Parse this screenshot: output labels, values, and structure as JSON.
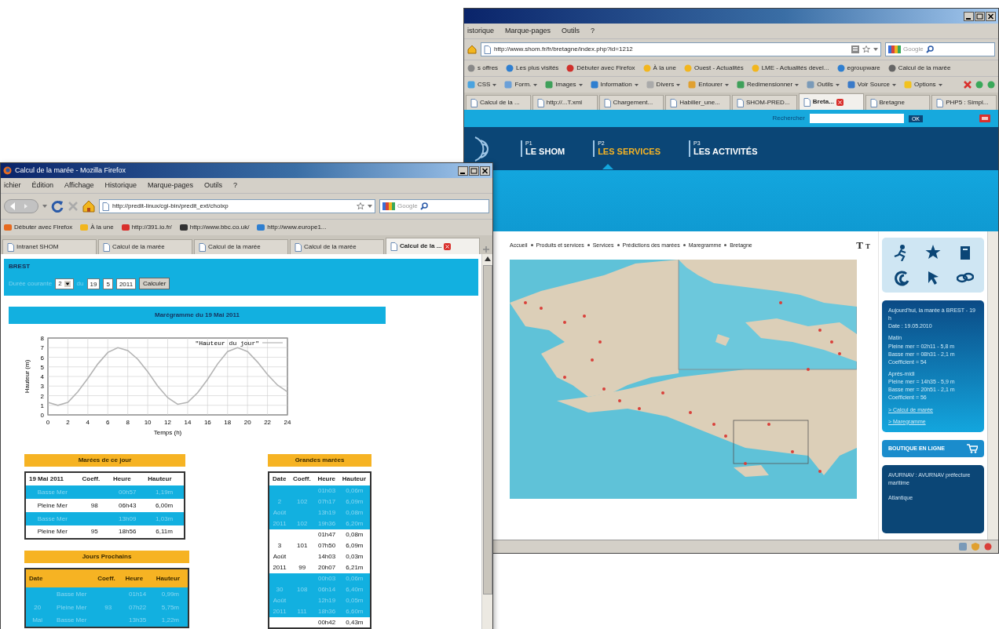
{
  "back_window": {
    "menu": [
      "istorique",
      "Marque-pages",
      "Outils",
      "?"
    ],
    "address": "http://www.shom.fr/fr/bretagne/index.php?id=1212",
    "search_placeholder": "Google",
    "bookmarks": [
      "s offres",
      "Les plus visités",
      "Débuter avec Firefox",
      "À la une",
      "Ouest - Actualités",
      "LME - Actualités devel...",
      "egroupware",
      "Calcul de la marée"
    ],
    "toolbar": [
      "CSS",
      "Form.",
      "Images",
      "Information",
      "Divers",
      "Entourer",
      "Redimensionner",
      "Outils",
      "Voir Source",
      "Options"
    ],
    "tabs": [
      {
        "label": "Calcul de la ...",
        "selected": false
      },
      {
        "label": "http://...T.xml",
        "selected": false
      },
      {
        "label": "Chargement...",
        "selected": false
      },
      {
        "label": "Habiller_une...",
        "selected": false
      },
      {
        "label": "SHOM-PRED...",
        "selected": false
      },
      {
        "label": "Breta...",
        "selected": true
      },
      {
        "label": "Bretagne",
        "selected": false
      },
      {
        "label": "PHP5 : Simpl...",
        "selected": false
      }
    ],
    "page": {
      "search_label": "Rechercher",
      "search_button": "OK",
      "nav": [
        {
          "number": "P1",
          "label": "LE SHOM",
          "selected": false
        },
        {
          "number": "P2",
          "label": "LES SERVICES",
          "selected": true
        },
        {
          "number": "P3",
          "label": "LES ACTIVITÉS",
          "selected": false
        }
      ],
      "breadcrumb": [
        "Accueil",
        "Produits et services",
        "Services",
        "Prédictions des marées",
        "Maregramme",
        "Bretagne"
      ],
      "text_size": [
        "T",
        "T"
      ],
      "tide_panel": [
        {
          "kind": "text",
          "text": "Aujourd'hui, la marée à BREST - 19 h"
        },
        {
          "kind": "text",
          "text": "Date : 19.05.2010"
        },
        {
          "kind": "heading",
          "text": "Matin"
        },
        {
          "kind": "text",
          "text": "Pleine mer = 02h11 - 5,8 m"
        },
        {
          "kind": "text",
          "text": "Basse mer = 08h31 - 2,1 m"
        },
        {
          "kind": "text",
          "text": "Coefficient = 54"
        },
        {
          "kind": "heading",
          "text": "Après-midi"
        },
        {
          "kind": "text",
          "text": "Pleine mer = 14h35 - 5,9 m"
        },
        {
          "kind": "text",
          "text": "Basse mer = 20h51 - 2,1 m"
        },
        {
          "kind": "text",
          "text": "Coefficient = 56"
        },
        {
          "kind": "link",
          "text": "> Calcul de marée"
        },
        {
          "kind": "link",
          "text": "> Maregramme"
        }
      ],
      "shop_button": "BOUTIQUE EN LIGNE",
      "notice_panel": [
        "AVURNAV : AVURNAV préfecture maritime",
        "Atlantique"
      ]
    }
  },
  "front_window": {
    "title": "Calcul de la marée - Mozilla Firefox",
    "menu": [
      "ichier",
      "Édition",
      "Affichage",
      "Historique",
      "Marque-pages",
      "Outils",
      "?"
    ],
    "address": "http://predit-linux/cgi-bin/predit_ext/choixp",
    "search_placeholder": "Google",
    "bookmarks": [
      "Débuter avec Firefox",
      "À la une",
      "http://391.io.fr/",
      "http://www.bbc.co.uk/",
      "http://www.europe1..."
    ],
    "tabs": [
      {
        "label": "Intranet SHOM",
        "selected": false
      },
      {
        "label": "Calcul de la marée",
        "selected": false
      },
      {
        "label": "Calcul de la marée",
        "selected": false
      },
      {
        "label": "Calcul de la marée",
        "selected": false
      },
      {
        "label": "Calcul de la ...",
        "selected": true
      }
    ],
    "page": {
      "port": "BREST",
      "form": {
        "label": "Durée courante",
        "select": "2",
        "date_label": "du",
        "day": "19",
        "month": "5",
        "year": "2011",
        "button": "Calculer"
      },
      "chart_title": "Marégramme du 19 Mai 2011",
      "chart_data": {
        "type": "line",
        "xlabel": "Temps (h)",
        "ylabel": "Hauteur (m)",
        "x": [
          0,
          1,
          2,
          3,
          4,
          5,
          6,
          7,
          8,
          9,
          10,
          11,
          12,
          13,
          14,
          15,
          16,
          17,
          18,
          19,
          20,
          21,
          22,
          23,
          24
        ],
        "series": [
          {
            "name": "\"Hauteur du jour\"",
            "color": "#b4b4b4",
            "values": [
              1.3,
              1.0,
              1.3,
              2.4,
              3.8,
              5.3,
              6.5,
              7.0,
              6.7,
              5.8,
              4.5,
              3.0,
              1.8,
              1.1,
              1.3,
              2.3,
              3.7,
              5.3,
              6.6,
              7.0,
              6.6,
              5.5,
              4.2,
              3.1,
              2.4
            ]
          }
        ],
        "xlim": [
          0,
          24
        ],
        "ylim": [
          0,
          8
        ],
        "grid": true,
        "xticks": [
          0,
          2,
          4,
          6,
          8,
          10,
          12,
          14,
          16,
          18,
          20,
          22,
          24
        ],
        "yticks": [
          0,
          1,
          2,
          3,
          4,
          5,
          6,
          7,
          8
        ]
      },
      "today": {
        "title": "Marées de ce jour",
        "columns": [
          "19 Mai 2011",
          "Coeff.",
          "Heure",
          "Hauteur"
        ],
        "rows": [
          {
            "highlighted": true,
            "cells": [
              "Basse Mer",
              null,
              "00h57",
              "1,19m"
            ]
          },
          {
            "highlighted": false,
            "cells": [
              "Pleine Mer",
              "98",
              "06h43",
              "6,00m"
            ]
          },
          {
            "highlighted": true,
            "cells": [
              "Basse Mer",
              null,
              "13h09",
              "1,03m"
            ]
          },
          {
            "highlighted": false,
            "cells": [
              "Pleine Mer",
              "95",
              "18h56",
              "6,11m"
            ]
          }
        ]
      },
      "next_days": {
        "title": "Jours Prochains",
        "columns": [
          "Date",
          null,
          "Coeff.",
          "Heure",
          "Hauteur"
        ],
        "rows": [
          {
            "highlighted": true,
            "cells": [
              null,
              "Basse Mer",
              null,
              "01h14",
              "0,99m"
            ]
          },
          {
            "highlighted": true,
            "cells": [
              "20",
              "Pleine Mer",
              "93",
              "07h22",
              "5,75m"
            ]
          },
          {
            "highlighted": true,
            "cells": [
              "Mai",
              "Basse Mer",
              null,
              "13h35",
              "1,22m"
            ]
          }
        ]
      },
      "spring_tides": {
        "title": "Grandes marées",
        "columns": [
          "Date",
          "Coeff.",
          "Heure",
          "Hauteur"
        ],
        "rows": [
          {
            "highlighted": true,
            "cells": [
              null,
              null,
              "01h03",
              "0,06m"
            ]
          },
          {
            "highlighted": true,
            "cells": [
              "2",
              "102",
              "07h17",
              "6,09m"
            ]
          },
          {
            "highlighted": true,
            "cells": [
              "Août",
              null,
              "13h19",
              "0,08m"
            ]
          },
          {
            "highlighted": true,
            "cells": [
              "2011",
              "102",
              "19h36",
              "6,20m"
            ]
          },
          {
            "highlighted": false,
            "cells": [
              null,
              null,
              "01h47",
              "0,08m"
            ]
          },
          {
            "highlighted": false,
            "cells": [
              "3",
              "101",
              "07h50",
              "6,09m"
            ]
          },
          {
            "highlighted": false,
            "cells": [
              "Août",
              null,
              "14h03",
              "0,03m"
            ]
          },
          {
            "highlighted": false,
            "cells": [
              "2011",
              "99",
              "20h07",
              "6,21m"
            ]
          },
          {
            "highlighted": true,
            "cells": [
              null,
              null,
              "00h03",
              "0,06m"
            ]
          },
          {
            "highlighted": true,
            "cells": [
              "30",
              "108",
              "06h14",
              "6,40m"
            ]
          },
          {
            "highlighted": true,
            "cells": [
              "Août",
              null,
              "12h19",
              "0,05m"
            ]
          },
          {
            "highlighted": true,
            "cells": [
              "2011",
              "111",
              "18h36",
              "6,60m"
            ]
          },
          {
            "highlighted": false,
            "cells": [
              null,
              null,
              "00h42",
              "0,43m"
            ]
          }
        ]
      }
    }
  }
}
